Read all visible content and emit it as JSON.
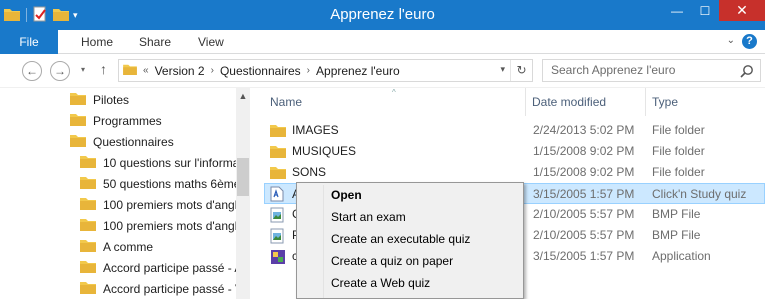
{
  "window": {
    "title": "Apprenez l'euro",
    "minimize": "—",
    "maximize": "☐",
    "close": "✕"
  },
  "qat": {
    "dropdown": "▾"
  },
  "ribbon": {
    "tabs": [
      "File",
      "Home",
      "Share",
      "View"
    ],
    "expand": "⌄",
    "help": "?"
  },
  "nav": {
    "back": "←",
    "forward": "→",
    "recent": "▾",
    "up": "↑",
    "breadcrumb_overflow": "«",
    "breadcrumbs": [
      "Version 2",
      "Questionnaires",
      "Apprenez l'euro"
    ],
    "separator": "›",
    "address_dropdown": "▾",
    "refresh": "↻",
    "search_placeholder": "Search Apprenez l'euro"
  },
  "sidebar": {
    "scroll_up": "▲",
    "items": [
      {
        "label": "Pilotes",
        "level": 0
      },
      {
        "label": "Programmes",
        "level": 0
      },
      {
        "label": "Questionnaires",
        "level": 0
      },
      {
        "label": "10 questions sur l'informa",
        "level": 1
      },
      {
        "label": "50 questions maths 6ème",
        "level": 1
      },
      {
        "label": "100 premiers mots d'angl",
        "level": 1
      },
      {
        "label": "100 premiers mots d'angl",
        "level": 1
      },
      {
        "label": "A comme",
        "level": 1
      },
      {
        "label": "Accord participe passé - A",
        "level": 1
      },
      {
        "label": "Accord participe passé - V",
        "level": 1
      }
    ]
  },
  "file_list": {
    "columns": {
      "name": "Name",
      "date": "Date modified",
      "type": "Type",
      "sort_indicator": "^"
    },
    "rows": [
      {
        "name": "IMAGES",
        "date": "2/24/2013 5:02 PM",
        "type": "File folder",
        "icon": "folder-icon",
        "selected": false
      },
      {
        "name": "MUSIQUES",
        "date": "1/15/2008 9:02 PM",
        "type": "File folder",
        "icon": "folder-icon",
        "selected": false
      },
      {
        "name": "SONS",
        "date": "1/15/2008 9:02 PM",
        "type": "File folder",
        "icon": "folder-icon",
        "selected": false
      },
      {
        "name": "A",
        "date": "3/15/2005 1:57 PM",
        "type": "Click'n Study quiz",
        "icon": "quiz-file-icon",
        "selected": true
      },
      {
        "name": "C",
        "date": "2/10/2005 5:57 PM",
        "type": "BMP File",
        "icon": "bmp-file-icon",
        "selected": false
      },
      {
        "name": "P",
        "date": "2/10/2005 5:57 PM",
        "type": "BMP File",
        "icon": "bmp-file-icon",
        "selected": false
      },
      {
        "name": "c",
        "date": "3/15/2005 1:57 PM",
        "type": "Application",
        "icon": "application-icon",
        "selected": false
      }
    ]
  },
  "context_menu": {
    "items": [
      "Open",
      "Start an exam",
      "Create an executable quiz",
      "Create a quiz on paper",
      "Create a Web quiz"
    ],
    "default_index": 0
  },
  "colors": {
    "accent": "#1979ca",
    "selection": "#cce8ff",
    "close_red": "#c7302b",
    "folder": "#f2c94c"
  }
}
